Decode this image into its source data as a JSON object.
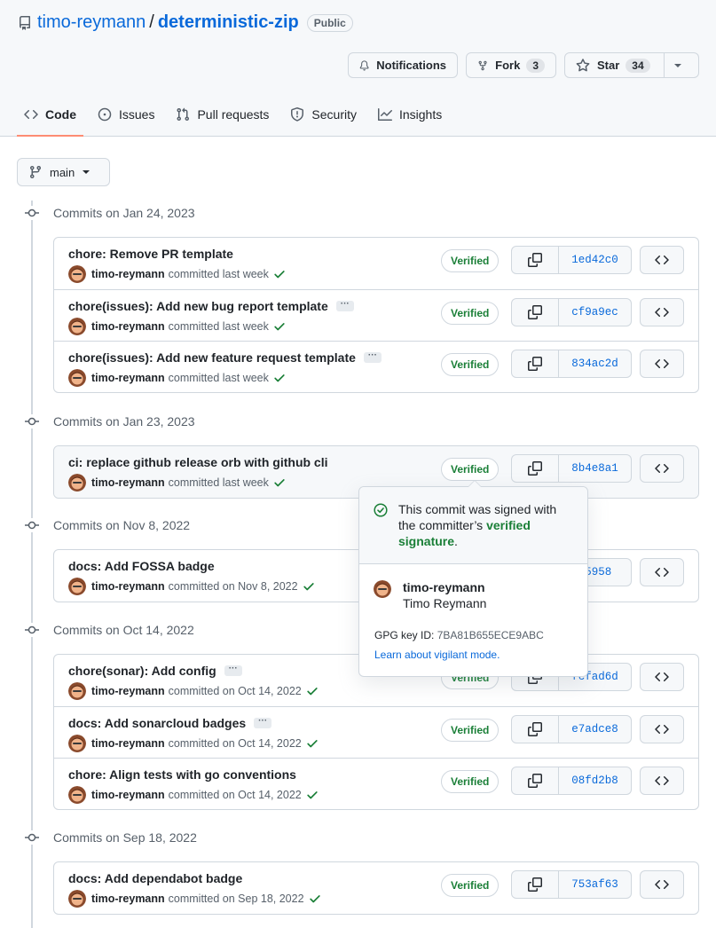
{
  "repo": {
    "owner": "timo-reymann",
    "separator": "/",
    "name": "deterministic-zip",
    "visibility": "Public"
  },
  "actions": {
    "notifications_label": "Notifications",
    "fork_label": "Fork",
    "fork_count": "3",
    "star_label": "Star",
    "star_count": "34"
  },
  "tabs": [
    {
      "label": "Code",
      "icon": "code-icon",
      "active": true
    },
    {
      "label": "Issues",
      "icon": "issue-icon"
    },
    {
      "label": "Pull requests",
      "icon": "pull-request-icon"
    },
    {
      "label": "Security",
      "icon": "shield-icon"
    },
    {
      "label": "Insights",
      "icon": "graph-icon"
    }
  ],
  "branch": {
    "label": "main"
  },
  "verified_label": "Verified",
  "groups": [
    {
      "heading": "Commits on Jan 24, 2023",
      "commits": [
        {
          "message": "chore: Remove PR template",
          "author": "timo-reymann",
          "when": "committed last week",
          "sha": "1ed42c0",
          "has_ellipsis": false
        },
        {
          "message": "chore(issues): Add new bug report template",
          "author": "timo-reymann",
          "when": "committed last week",
          "sha": "cf9a9ec",
          "has_ellipsis": true
        },
        {
          "message": "chore(issues): Add new feature request template",
          "author": "timo-reymann",
          "when": "committed last week",
          "sha": "834ac2d",
          "has_ellipsis": true
        }
      ]
    },
    {
      "heading": "Commits on Jan 23, 2023",
      "commits": [
        {
          "message": "ci: replace github release orb with github cli",
          "author": "timo-reymann",
          "when": "committed last week",
          "sha": "8b4e8a1",
          "has_ellipsis": false
        }
      ]
    },
    {
      "heading": "Commits on Nov 8, 2022",
      "commits": [
        {
          "message": "docs: Add FOSSA badge",
          "author": "timo-reymann",
          "when": "committed on Nov 8, 2022",
          "sha": "55958",
          "has_ellipsis": false
        }
      ]
    },
    {
      "heading": "Commits on Oct 14, 2022",
      "commits": [
        {
          "message": "chore(sonar): Add config",
          "author": "timo-reymann",
          "when": "committed on Oct 14, 2022",
          "sha": "fcfad6d",
          "has_ellipsis": true
        },
        {
          "message": "docs: Add sonarcloud badges",
          "author": "timo-reymann",
          "when": "committed on Oct 14, 2022",
          "sha": "e7adce8",
          "has_ellipsis": true
        },
        {
          "message": "chore: Align tests with go conventions",
          "author": "timo-reymann",
          "when": "committed on Oct 14, 2022",
          "sha": "08fd2b8",
          "has_ellipsis": false
        }
      ]
    },
    {
      "heading": "Commits on Sep 18, 2022",
      "commits": [
        {
          "message": "docs: Add dependabot badge",
          "author": "timo-reymann",
          "when": "committed on Sep 18, 2022",
          "sha": "753af63",
          "has_ellipsis": false
        }
      ]
    }
  ],
  "popover": {
    "text_before": "This commit was signed with the committer’s ",
    "text_link": "verified signature",
    "text_after": ".",
    "login": "timo-reymann",
    "full_name": "Timo Reymann",
    "gpg_label": "GPG key ID: ",
    "gpg_key": "7BA81B655ECE9ABC",
    "learn_link": "Learn about vigilant mode."
  },
  "colors": {
    "link": "#0969da",
    "verified_green": "#1a7f37",
    "active_tab_underline": "#fd8c73",
    "border": "#d0d7de"
  }
}
